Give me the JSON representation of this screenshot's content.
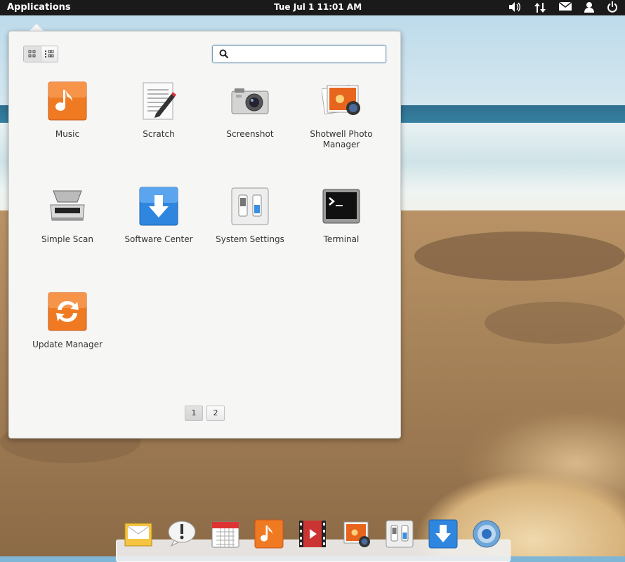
{
  "panel": {
    "applications_label": "Applications",
    "clock": "Tue Jul  1 11:01 AM",
    "indicators": [
      "volume-icon",
      "network-icon",
      "mail-icon",
      "user-icon",
      "power-icon"
    ]
  },
  "launcher": {
    "search": {
      "value": "",
      "placeholder": ""
    },
    "apps": [
      {
        "label": "Music",
        "icon": "music-icon"
      },
      {
        "label": "Scratch",
        "icon": "scratch-icon"
      },
      {
        "label": "Screenshot",
        "icon": "camera-icon"
      },
      {
        "label": "Shotwell Photo Manager",
        "icon": "shotwell-icon"
      },
      {
        "label": "Simple Scan",
        "icon": "scanner-icon"
      },
      {
        "label": "Software Center",
        "icon": "software-center-icon"
      },
      {
        "label": "System Settings",
        "icon": "settings-icon"
      },
      {
        "label": "Terminal",
        "icon": "terminal-icon"
      },
      {
        "label": "Update Manager",
        "icon": "update-icon"
      }
    ],
    "pages": [
      "1",
      "2"
    ],
    "active_page": "1"
  },
  "dock": {
    "items": [
      "mail-icon",
      "notifications-icon",
      "calendar-icon",
      "music-icon",
      "video-icon",
      "shotwell-icon",
      "settings-icon",
      "software-center-icon",
      "browser-icon"
    ]
  },
  "colors": {
    "panel_bg": "#1a1a1a",
    "launcher_bg": "#f6f6f5",
    "orange": "#f07c24",
    "blue": "#3a8fe0"
  }
}
